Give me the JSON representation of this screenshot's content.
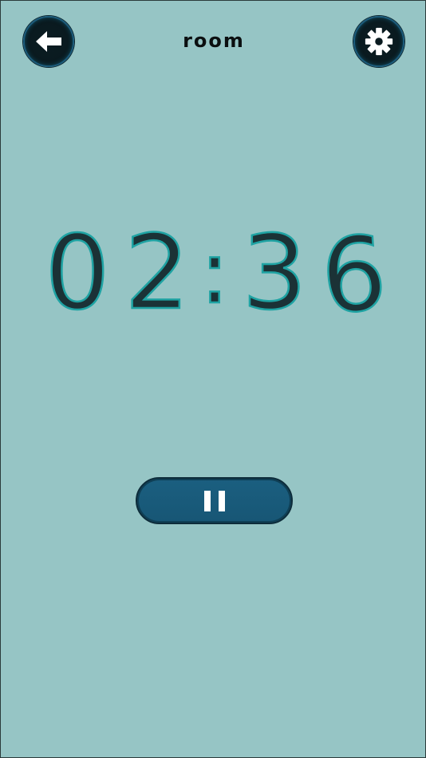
{
  "header": {
    "title": "room",
    "back_icon": "arrow-left-icon",
    "settings_icon": "gear-icon"
  },
  "timer": {
    "minutes": "02",
    "seconds": "36",
    "separator": ":"
  },
  "controls": {
    "pause_icon": "pause-icon"
  },
  "colors": {
    "background": "#96c5c5",
    "digit_fill": "#1b3236",
    "digit_outline": "#1fa3a3",
    "button_dark": "#0a1a1f",
    "button_blue": "#1b5f80"
  }
}
